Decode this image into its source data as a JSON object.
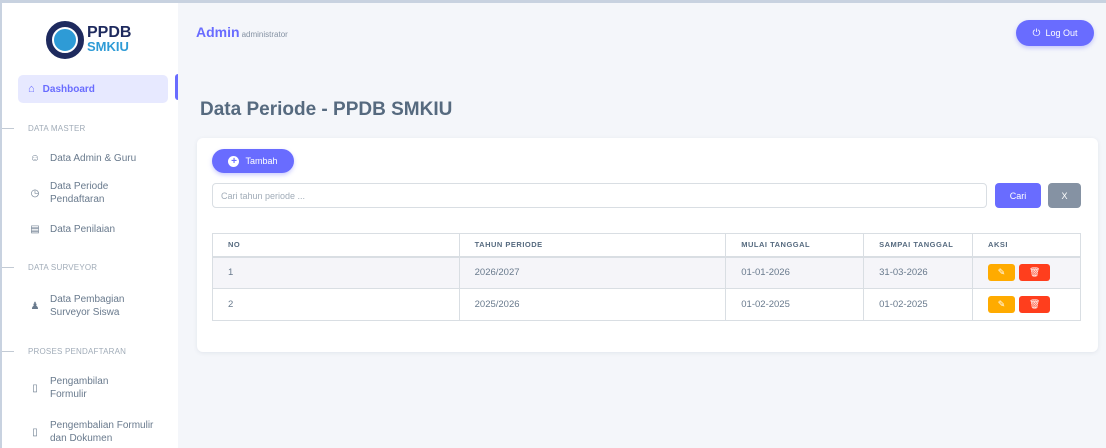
{
  "brand": {
    "line1": "PPDB",
    "line2": "SMKIU"
  },
  "topbar": {
    "title": "Admin",
    "subtitle": "administrator",
    "logout_label": "Log Out"
  },
  "sidebar": {
    "active": {
      "label": "Dashboard",
      "icon": "home-icon"
    },
    "sections": [
      {
        "label": "DATA MASTER"
      },
      {
        "label": "DATA SURVEYOR"
      },
      {
        "label": "PROSES PENDAFTARAN"
      }
    ],
    "items": [
      {
        "line1": "Data Admin & Guru",
        "line2": "",
        "icon": "users-icon"
      },
      {
        "line1": "Data Periode",
        "line2": "Pendaftaran",
        "icon": "clock-icon"
      },
      {
        "line1": "Data Penilaian",
        "line2": "",
        "icon": "document-icon"
      },
      {
        "line1": "Data Pembagian",
        "line2": "Surveyor Siswa",
        "icon": "user-group-icon"
      },
      {
        "line1": "Pengambilan",
        "line2": "Formulir",
        "icon": "file-icon"
      },
      {
        "line1": "Pengembalian Formulir",
        "line2": "dan Dokumen",
        "icon": "file-icon"
      }
    ]
  },
  "page": {
    "title": "Data Periode - PPDB SMKIU"
  },
  "toolbar": {
    "add_label": "Tambah",
    "search_placeholder": "Cari tahun periode ...",
    "search_label": "Cari",
    "clear_label": "X"
  },
  "table": {
    "headers": [
      "NO",
      "TAHUN PERIODE",
      "MULAI TANGGAL",
      "SAMPAI TANGGAL",
      "AKSI"
    ],
    "rows": [
      {
        "no": "1",
        "tahun": "2026/2027",
        "mulai": "01-01-2026",
        "sampai": "31-03-2026"
      },
      {
        "no": "2",
        "tahun": "2025/2026",
        "mulai": "01-02-2025",
        "sampai": "01-02-2025"
      }
    ]
  },
  "colors": {
    "primary": "#696cff",
    "warning": "#ffab00",
    "danger": "#ff3e1d",
    "secondary": "#8592a3"
  }
}
